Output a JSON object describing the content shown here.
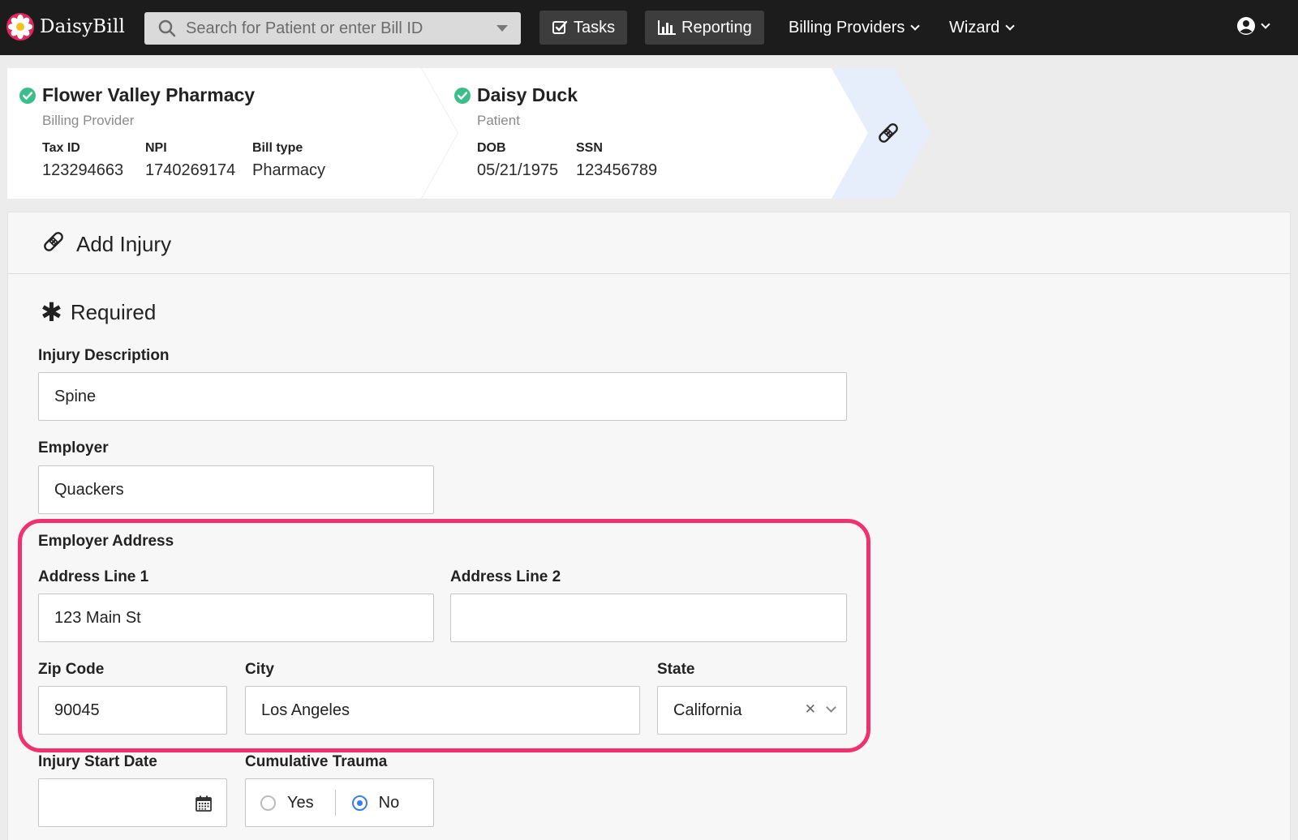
{
  "nav": {
    "brand": "DaisyBill",
    "search_placeholder": "Search for Patient or enter Bill ID",
    "tasks": "Tasks",
    "reporting": "Reporting",
    "billing_providers": "Billing Providers",
    "wizard": "Wizard"
  },
  "provider": {
    "name": "Flower Valley Pharmacy",
    "role": "Billing Provider",
    "tax_id_label": "Tax ID",
    "tax_id": "123294663",
    "npi_label": "NPI",
    "npi": "1740269174",
    "bill_type_label": "Bill type",
    "bill_type": "Pharmacy"
  },
  "patient": {
    "name": "Daisy Duck",
    "role": "Patient",
    "dob_label": "DOB",
    "dob": "05/21/1975",
    "ssn_label": "SSN",
    "ssn": "123456789"
  },
  "form": {
    "title": "Add Injury",
    "required": "Required",
    "injury_description_label": "Injury Description",
    "injury_description": "Spine",
    "employer_label": "Employer",
    "employer": "Quackers",
    "employer_address_label": "Employer Address",
    "address1_label": "Address Line 1",
    "address1": "123 Main St",
    "address2_label": "Address Line 2",
    "address2": "",
    "zip_label": "Zip Code",
    "zip": "90045",
    "city_label": "City",
    "city": "Los Angeles",
    "state_label": "State",
    "state": "California",
    "injury_start_label": "Injury Start Date",
    "injury_start": "",
    "cumulative_label": "Cumulative Trauma",
    "yes": "Yes",
    "no": "No",
    "cumulative_selected": "No"
  },
  "colors": {
    "highlight": "#f0306f",
    "check": "#3bbf8a",
    "radio_selected": "#3b7de0"
  },
  "icons": [
    "search-icon",
    "tasks-check-icon",
    "bar-chart-icon",
    "user-icon",
    "bandage-icon",
    "check-circle-icon",
    "calendar-icon"
  ]
}
